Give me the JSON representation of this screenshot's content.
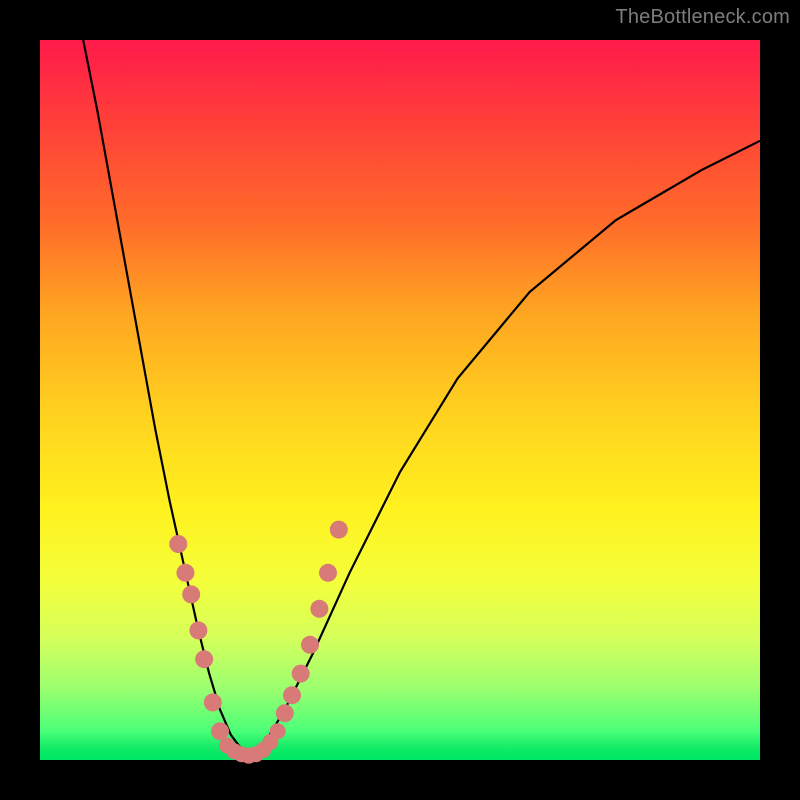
{
  "watermark": "TheBottleneck.com",
  "colors": {
    "background": "#000000",
    "gradient_top": "#ff1a4b",
    "gradient_bottom": "#00ef63",
    "curve": "#000000",
    "dot": "#d77a78",
    "watermark": "#7d7d7d"
  },
  "chart_data": {
    "type": "line",
    "title": "",
    "xlabel": "",
    "ylabel": "",
    "xlim": [
      0,
      100
    ],
    "ylim": [
      0,
      100
    ],
    "grid": false,
    "legend": false,
    "annotations": [],
    "background_gradient": "red-to-green (top-to-bottom) indicating bottleneck severity",
    "series": [
      {
        "name": "left-curve",
        "description": "steep descending curve from top-left to valley",
        "x": [
          6,
          8,
          10,
          12,
          14,
          16,
          18,
          20,
          22,
          23.5,
          25,
          26.5,
          28,
          29
        ],
        "y": [
          100,
          90,
          79,
          68,
          57,
          46,
          36,
          27,
          18,
          12,
          7,
          3.5,
          1.5,
          0.5
        ]
      },
      {
        "name": "right-curve",
        "description": "ascending curve from valley to upper-right",
        "x": [
          29,
          31,
          34,
          38,
          43,
          50,
          58,
          68,
          80,
          92,
          100
        ],
        "y": [
          0.5,
          2,
          7,
          15,
          26,
          40,
          53,
          65,
          75,
          82,
          86
        ]
      },
      {
        "name": "dots-left-descent",
        "type": "scatter",
        "description": "salmon dots along lower portion of left curve",
        "x": [
          19.2,
          20.2,
          21.0,
          22.0,
          22.8,
          24.0,
          25.0
        ],
        "y": [
          30,
          26,
          23,
          18,
          14,
          8,
          4
        ]
      },
      {
        "name": "dots-valley",
        "type": "scatter",
        "description": "salmon dots clustered at valley floor",
        "x": [
          26.0,
          27.0,
          28.0,
          29.0,
          30.0,
          31.0,
          32.0,
          33.0
        ],
        "y": [
          2.0,
          1.2,
          0.8,
          0.6,
          0.8,
          1.4,
          2.5,
          4.0
        ]
      },
      {
        "name": "dots-right-ascent",
        "type": "scatter",
        "description": "salmon dots along lower portion of right curve",
        "x": [
          34.0,
          35.0,
          36.2,
          37.5,
          38.8,
          40.0,
          41.5
        ],
        "y": [
          6.5,
          9,
          12,
          16,
          21,
          26,
          32
        ]
      }
    ]
  }
}
